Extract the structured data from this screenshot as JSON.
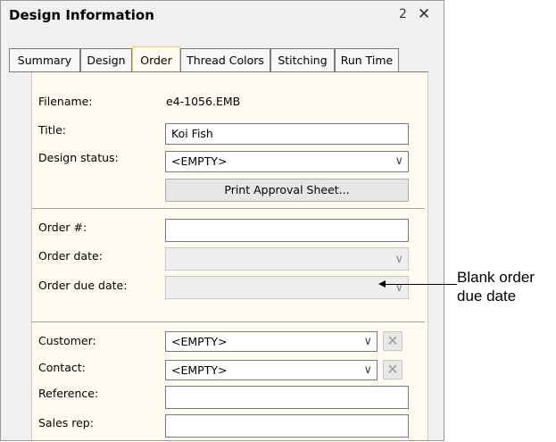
{
  "window": {
    "title": "Design Information"
  },
  "tabs": [
    {
      "label": "Summary",
      "active": false
    },
    {
      "label": "Design",
      "active": false
    },
    {
      "label": "Order",
      "active": true
    },
    {
      "label": "Thread Colors",
      "active": false
    },
    {
      "label": "Stitching",
      "active": false
    },
    {
      "label": "Run Time",
      "active": false
    }
  ],
  "order": {
    "filename_label": "Filename:",
    "filename_value": "e4-1056.EMB",
    "title_label": "Title:",
    "title_value": "Koi Fish",
    "status_label": "Design status:",
    "status_value": "<EMPTY>",
    "print_button": "Print Approval Sheet...",
    "order_no_label": "Order #:",
    "order_no_value": "",
    "order_date_label": "Order date:",
    "order_date_value": "",
    "due_date_label": "Order due date:",
    "due_date_value": "",
    "customer_label": "Customer:",
    "customer_value": "<EMPTY>",
    "contact_label": "Contact:",
    "contact_value": "<EMPTY>",
    "reference_label": "Reference:",
    "reference_value": "",
    "sales_rep_label": "Sales rep:",
    "sales_rep_value": ""
  },
  "callout": {
    "line1": "Blank order",
    "line2": "due date"
  },
  "icons": {
    "pin": "pin-icon",
    "close": "close-icon",
    "dropdown": "chevron-down-icon",
    "clear": "clear-x-icon"
  }
}
